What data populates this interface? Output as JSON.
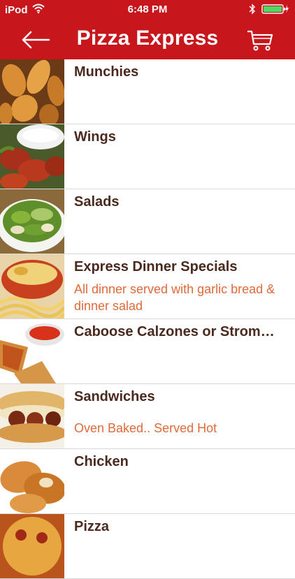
{
  "status_bar": {
    "carrier": "iPod",
    "time": "6:48 PM"
  },
  "nav": {
    "title": "Pizza Express"
  },
  "categories": [
    {
      "title": "Munchies",
      "subtitle": ""
    },
    {
      "title": "Wings",
      "subtitle": ""
    },
    {
      "title": "Salads",
      "subtitle": ""
    },
    {
      "title": "Express Dinner Specials",
      "subtitle": "All dinner served with garlic bread & dinner salad"
    },
    {
      "title": "Caboose Calzones or Stromboli",
      "subtitle": ""
    },
    {
      "title": "Sandwiches",
      "subtitle": "Oven Baked.. Served Hot"
    },
    {
      "title": "Chicken",
      "subtitle": ""
    },
    {
      "title": "Pizza",
      "subtitle": ""
    }
  ],
  "colors": {
    "header": "#c8161d",
    "title_text": "#4a2a1e",
    "subtitle_text": "#e06a3a"
  }
}
